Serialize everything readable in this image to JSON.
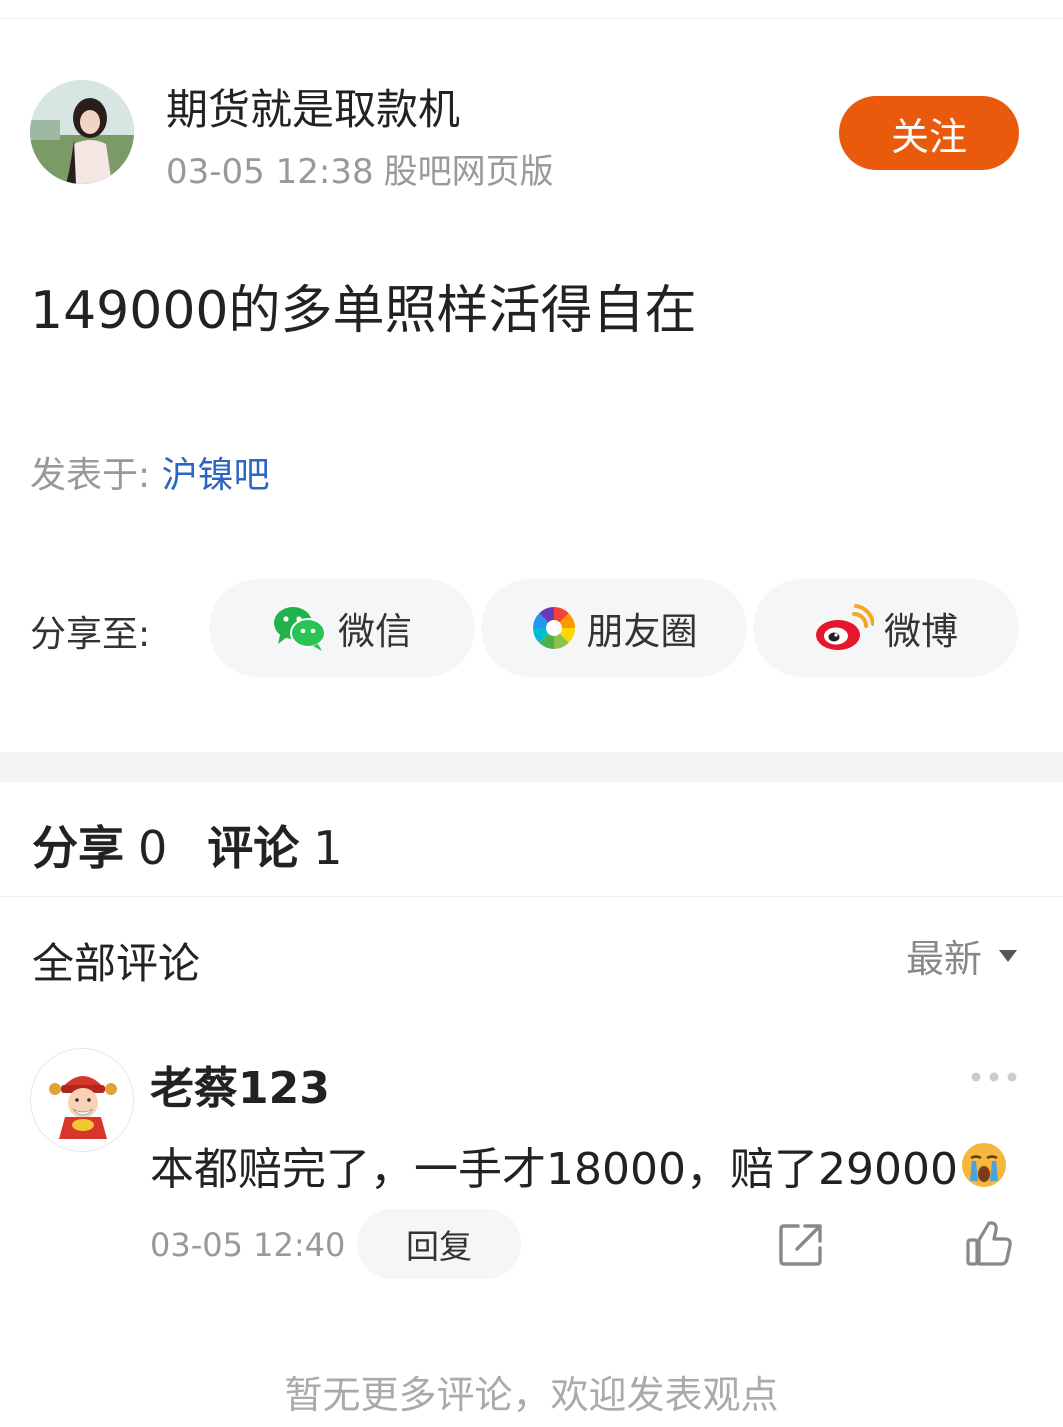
{
  "post": {
    "author": "期货就是取款机",
    "timestamp": "03-05 12:38",
    "source": "股吧网页版",
    "follow_label": "关注",
    "content": "149000的多单照样活得自在",
    "posted_in_label": "发表于: ",
    "bar_name": "沪镍吧"
  },
  "share": {
    "label": "分享至:",
    "targets": [
      {
        "label": "微信",
        "icon": "wechat-icon"
      },
      {
        "label": "朋友圈",
        "icon": "moments-icon"
      },
      {
        "label": "微博",
        "icon": "weibo-icon"
      }
    ]
  },
  "tabs": [
    {
      "label": "分享",
      "count": "0"
    },
    {
      "label": "评论",
      "count": "1"
    }
  ],
  "comments_section": {
    "title": "全部评论",
    "sort_label": "最新"
  },
  "comments": [
    {
      "author": "老蔡123",
      "text": "本都赔完了，一手才18000，赔了29000",
      "emoji": "crying-face-icon",
      "time": "03-05 12:40",
      "reply_label": "回复"
    }
  ],
  "footer": {
    "no_more": "暂无更多评论，欢迎发表观点"
  },
  "colors": {
    "accent": "#ea5a0c",
    "link": "#2d66c2"
  }
}
